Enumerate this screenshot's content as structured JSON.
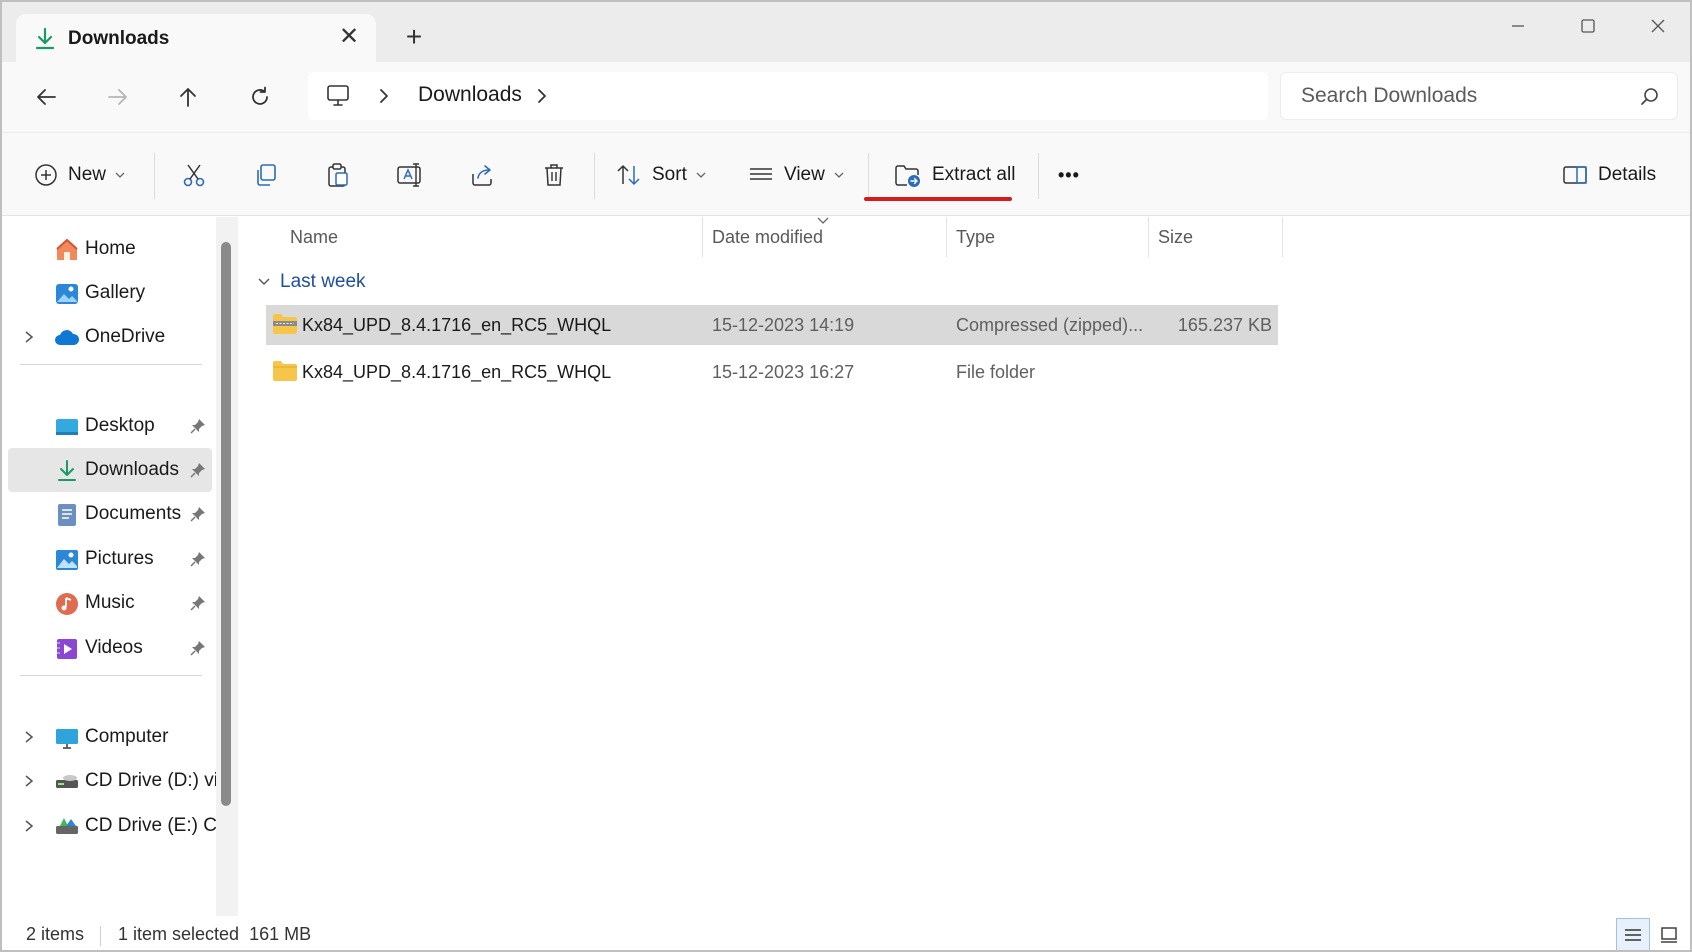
{
  "tab": {
    "title": "Downloads",
    "close": "✕",
    "new_tab": "+"
  },
  "address": {
    "breadcrumb": [
      "Downloads"
    ],
    "search_placeholder": "Search Downloads"
  },
  "commands": {
    "new_label": "New",
    "sort_label": "Sort",
    "view_label": "View",
    "extract_label": "Extract all",
    "more_label": "•••",
    "details_label": "Details"
  },
  "sidebar": {
    "items": [
      {
        "label": "Home"
      },
      {
        "label": "Gallery"
      },
      {
        "label": "OneDrive"
      },
      {
        "label": "Desktop"
      },
      {
        "label": "Downloads"
      },
      {
        "label": "Documents"
      },
      {
        "label": "Pictures"
      },
      {
        "label": "Music"
      },
      {
        "label": "Videos"
      },
      {
        "label": "Computer"
      },
      {
        "label": "CD Drive (D:) vir"
      },
      {
        "label": "CD Drive (E:) CC"
      }
    ]
  },
  "columns": {
    "name": "Name",
    "date": "Date modified",
    "type": "Type",
    "size": "Size"
  },
  "group": {
    "label": "Last week"
  },
  "files": [
    {
      "name": "Kx84_UPD_8.4.1716_en_RC5_WHQL",
      "date": "15-12-2023 14:19",
      "type": "Compressed (zipped)...",
      "size": "165.237 KB"
    },
    {
      "name": "Kx84_UPD_8.4.1716_en_RC5_WHQL",
      "date": "15-12-2023 16:27",
      "type": "File folder",
      "size": ""
    }
  ],
  "status": {
    "count": "2 items",
    "selection": "1 item selected  161 MB"
  },
  "colors": {
    "accent": "#0067c0",
    "highlight_underline": "#d41c1c",
    "group_header": "#1f4e9c"
  }
}
